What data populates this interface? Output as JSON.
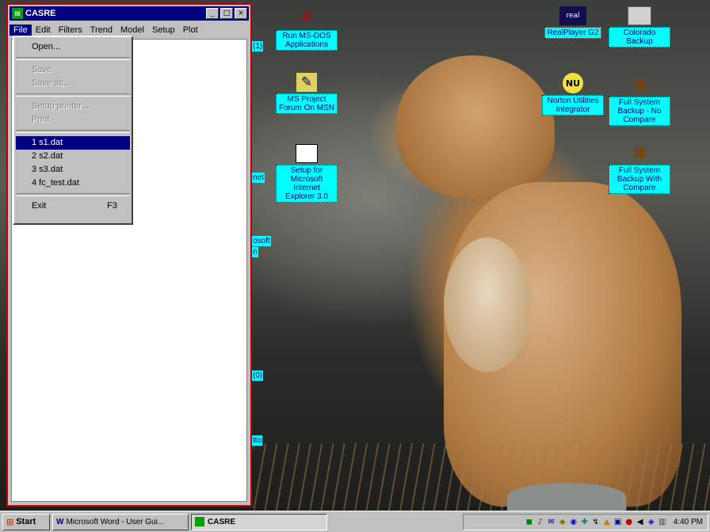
{
  "window": {
    "title": "CASRE",
    "title_icon": "casre-app-icon",
    "controls": {
      "minimize": "_",
      "maximize": "□",
      "close": "×"
    },
    "menu": [
      "File",
      "Edit",
      "Filters",
      "Trend",
      "Model",
      "Setup",
      "Plot"
    ],
    "active_menu": "File"
  },
  "file_menu": {
    "open": "Open...",
    "disabled_1": "Save",
    "disabled_2": "Save as...",
    "disabled_3": "Setup printer...",
    "disabled_4": "Print",
    "recent": [
      "1 s1.dat",
      "2 s2.dat",
      "3 s3.dat",
      "4 fc_test.dat"
    ],
    "exit": "Exit",
    "exit_shortcut": "F3"
  },
  "desktop_icons": {
    "msdos": "Run MS-DOS Applications",
    "msproject": "MS Project Forum On MSN",
    "ie_setup": "Setup for Microsoft Internet Explorer 3.0",
    "realplayer": "RealPlayer G2",
    "colorado": "Colorado Backup",
    "norton": "Norton Utilities Integrator",
    "backup_nocompare": "Full System Backup - No Compare",
    "backup_compare": "Full System Backup With Compare"
  },
  "partial_labels": [
    "(1)",
    "net",
    "osoft",
    "n",
    "(0)",
    "tto"
  ],
  "taskbar": {
    "start": "Start",
    "word_task": "Microsoft Word - User Gui...",
    "casre_task": "CASRE",
    "clock": "4:40 PM"
  },
  "colors": {
    "title_bar": "#000080",
    "icon_label_bg": "#00ffff",
    "window_frame": "#c00000"
  }
}
